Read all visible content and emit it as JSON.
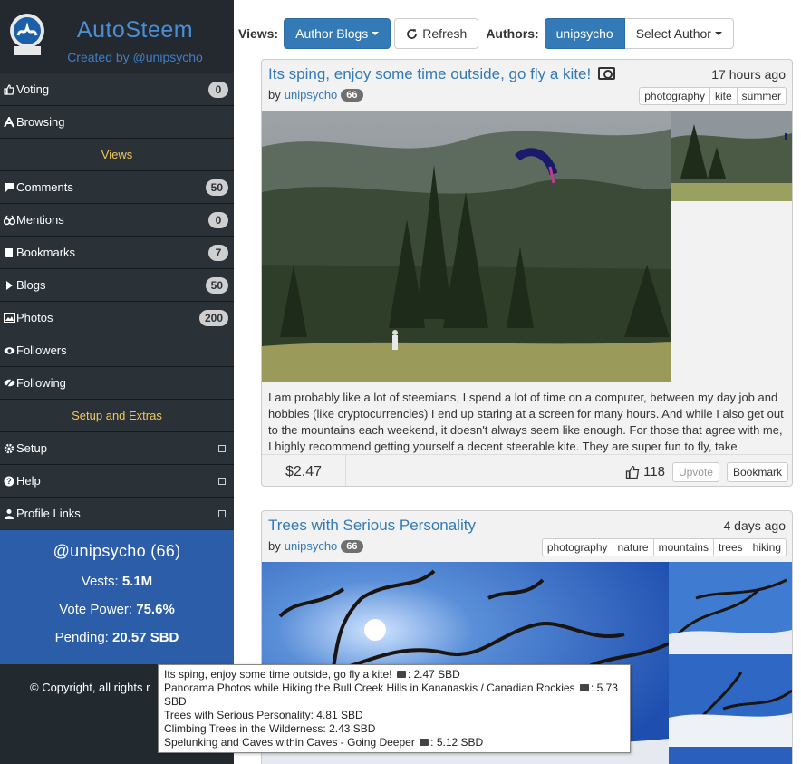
{
  "app": {
    "title": "AutoSteem",
    "subtitle": "Created by @unipsycho"
  },
  "sidebar": {
    "items_top": [
      {
        "label": "Voting",
        "badge": "0",
        "icon": "thumbs-up-icon"
      },
      {
        "label": "Browsing",
        "icon": "font-icon"
      }
    ],
    "views_header": "Views",
    "views": [
      {
        "label": "Comments",
        "badge": "50",
        "icon": "comment-icon"
      },
      {
        "label": "Mentions",
        "badge": "0",
        "icon": "binoculars-icon"
      },
      {
        "label": "Bookmarks",
        "badge": "7",
        "icon": "book-icon"
      },
      {
        "label": "Blogs",
        "badge": "50",
        "icon": "play-icon"
      },
      {
        "label": "Photos",
        "badge": "200",
        "icon": "picture-icon"
      },
      {
        "label": "Followers",
        "icon": "eye-icon"
      },
      {
        "label": "Following",
        "icon": "eye-slash-icon"
      }
    ],
    "setup_header": "Setup and Extras",
    "setup": [
      {
        "label": "Setup",
        "icon": "gear-icon"
      },
      {
        "label": "Help",
        "icon": "question-icon"
      },
      {
        "label": "Profile Links",
        "icon": "user-icon"
      }
    ],
    "stats": {
      "user": "@unipsycho (66)",
      "vests_label": "Vests:",
      "vests_value": "5.1M",
      "vp_label": "Vote Power:",
      "vp_value": "75.6%",
      "pending_label": "Pending:",
      "pending_value": "20.57 SBD"
    },
    "copyright": "© Copyright, all rights r"
  },
  "toolbar": {
    "views_label": "Views:",
    "view_select": "Author Blogs",
    "refresh": "Refresh",
    "authors_label": "Authors:",
    "author_active": "unipsycho",
    "author_select": "Select Author"
  },
  "posts": [
    {
      "title": "Its sping, enjoy some time outside, go fly a kite!",
      "time": "17 hours ago",
      "by": "by",
      "author": "unipsycho",
      "rep": "66",
      "tags": [
        "photography",
        "kite",
        "summer"
      ],
      "body": "I am probably like a lot of steemians, I spend a lot of time on a computer, between my day job and hobbies (like cryptocurrencies) I end up staring at a screen for many hours. And while I also get out to the mountains each weekend, it doesn't always seem like enough. For those that agree with me, I highly recommend getting yourself a decent steerable kite. They are super fun to fly, take",
      "payout": "$2.47",
      "votes": "118",
      "upvote": "Upvote",
      "bookmark": "Bookmark"
    },
    {
      "title": "Trees with Serious Personality",
      "time": "4 days ago",
      "by": "by",
      "author": "unipsycho",
      "rep": "66",
      "tags": [
        "photography",
        "nature",
        "mountains",
        "trees",
        "hiking"
      ]
    }
  ],
  "tooltip": {
    "lines": [
      {
        "text": "Its sping, enjoy some time outside, go fly a kite!",
        "photo": true,
        "value": ": 2.47 SBD"
      },
      {
        "text": "Panorama Photos while Hiking the Bull Creek Hills in Kananaskis / Canadian Rockies",
        "photo": true,
        "value": ": 5.73 SBD"
      },
      {
        "text": "Trees with Serious Personality",
        "photo": false,
        "value": ": 4.81 SBD"
      },
      {
        "text": "Climbing Trees in the Wilderness",
        "photo": false,
        "value": ": 2.43 SBD"
      },
      {
        "text": "Spelunking and Caves within Caves - Going Deeper",
        "photo": true,
        "value": ": 5.12 SBD"
      }
    ]
  },
  "colors": {
    "sidebar_bg": "#2a3238",
    "brand_blue": "#4a8fd6",
    "accent": "#337ab7",
    "header_gold": "#f0c85a",
    "stats_bg": "#2b5da8"
  }
}
